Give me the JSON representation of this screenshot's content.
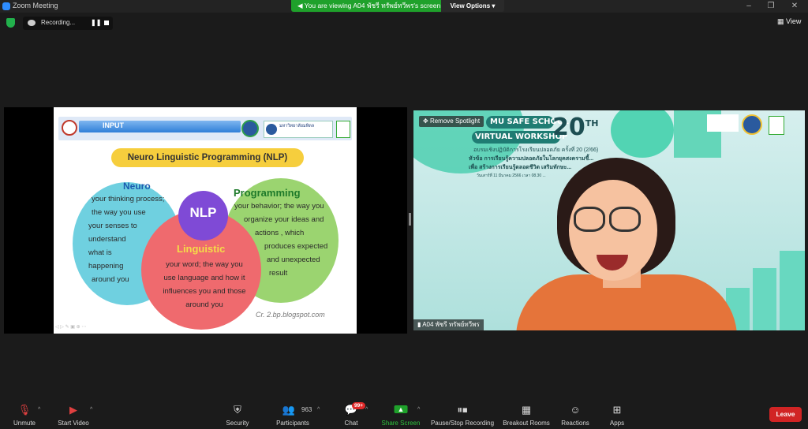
{
  "window": {
    "title": "Zoom Meeting",
    "viewing_banner": "You are viewing A04 พัชรี ทรัพย์ทวีพร's screen",
    "view_options": "View Options ▾",
    "controls": [
      "–",
      "❐",
      "✕"
    ]
  },
  "recording": {
    "label": "Recording...",
    "pause": "❚❚"
  },
  "view_button": "View",
  "slide": {
    "banner": "INPUT",
    "university": "มหาวิทยาลัยมหิดล",
    "title": "Neuro Linguistic Programming (NLP)",
    "center": "NLP",
    "neuro": {
      "heading": "Neuro",
      "lines": [
        "your thinking process;",
        "the way you use",
        "your senses to",
        "understand",
        "what is",
        "happening",
        "around you"
      ]
    },
    "programming": {
      "heading": "Programming",
      "lines": [
        "your behavior; the way you",
        "organize your ideas and",
        "actions , which",
        "produces expected",
        "and unexpected",
        "result"
      ]
    },
    "linguistic": {
      "heading": "Linguistic",
      "lines": [
        "your word; the way you",
        "use language and how it",
        "influences you and those",
        "around you"
      ]
    },
    "credit": "Cr. 2.bp.blogspot.com"
  },
  "video": {
    "remove_spotlight": "Remove Spotlight",
    "workshop_line1": "MU SAFE SCHOOL",
    "workshop_line2": "VIRTUAL WORKSHOP",
    "number": "20",
    "sup": "TH",
    "thai_line1": "อบรมเชิงปฏิบัติการโรงเรียนปลอดภัย ครั้งที่ 20 (2/66)",
    "thai_line2": "หัวข้อ การเรียนรู้ความปลอดภัยในโลกยุคสงครามชี้...",
    "thai_line3": "เพื่อ สร้างการเรียนรู้ตลอดชีวิต เสริมทักษะ...",
    "thai_line4": "วันเสาร์ที่ 11 มีนาคม 2566 เวลา 08.30 ...",
    "name_tag": "A04 พัชรี ทรัพย์ทวีพร"
  },
  "toolbar": {
    "unmute": "Unmute",
    "start_video": "Start Video",
    "security": "Security",
    "participants": "Participants",
    "participants_count": "963",
    "chat": "Chat",
    "chat_badge": "99+",
    "share_screen": "Share Screen",
    "pause_stop": "Pause/Stop Recording",
    "breakout": "Breakout Rooms",
    "reactions": "Reactions",
    "apps": "Apps",
    "leave": "Leave"
  },
  "colors": {
    "share_green": "#1fa12b",
    "leave_red": "#d12424",
    "nlp_purple": "#7f4ad6",
    "neuro_cyan": "#6fd0e0",
    "programming_green": "#9bd470",
    "linguistic_red": "#ef6a6e"
  }
}
